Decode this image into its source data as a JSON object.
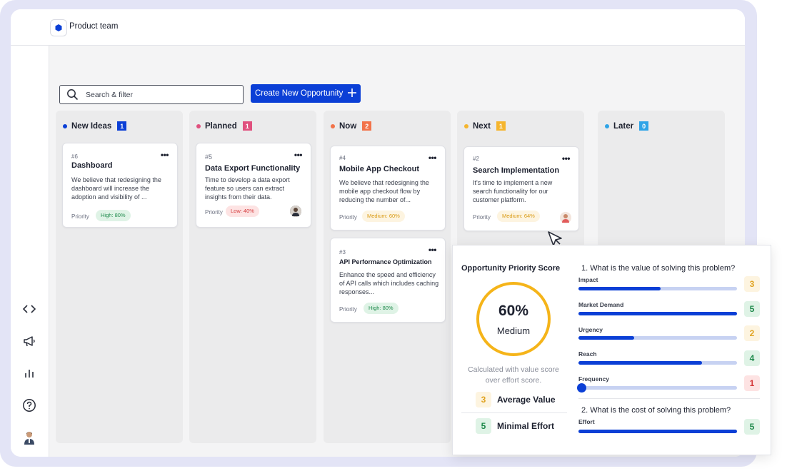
{
  "workspace": {
    "name": "Product team"
  },
  "toolbar": {
    "search_placeholder": "Search & filter",
    "create_label": "Create New Opportunity"
  },
  "colors": {
    "accent": "#0b3fd6",
    "high": "#1f9d55",
    "medium": "#e0a321",
    "low": "#e0484a"
  },
  "sidebar": {
    "icons": [
      "code-icon",
      "megaphone-icon",
      "bar-chart-icon",
      "help-icon",
      "user-avatar"
    ]
  },
  "columns": [
    {
      "name": "New Ideas",
      "count": "1",
      "color": "#0b3fd6",
      "cards": [
        {
          "num": "#6",
          "title": "Dashboard",
          "desc": "We believe that redesigning the dashboard will increase the adoption and visibility of ...",
          "priority_label": "Priority",
          "priority": "High: 80%"
        }
      ]
    },
    {
      "name": "Planned",
      "count": "1",
      "color": "#e0507e",
      "cards": [
        {
          "num": "#5",
          "title": "Data Export Functionality",
          "desc": "Time to develop a data export feature so users can extract insights from their data.",
          "priority_label": "Priority",
          "priority": "Low: 40%"
        }
      ]
    },
    {
      "name": "Now",
      "count": "2",
      "color": "#f2734a",
      "cards": [
        {
          "num": "#4",
          "title": "Mobile App Checkout",
          "desc": "We believe that redesigning the mobile app checkout flow by reducing the number of...",
          "priority_label": "Priority",
          "priority": "Medium: 60%"
        },
        {
          "num": "#3",
          "title": "API Performance Optimization",
          "desc": "Enhance the speed and efficiency of API calls which includes caching responses...",
          "priority_label": "Priority",
          "priority": "High: 80%"
        }
      ]
    },
    {
      "name": "Next",
      "count": "1",
      "color": "#f5b52e",
      "cards": [
        {
          "num": "#2",
          "title": "Search Implementation",
          "desc": "It's time to implement a new search functionality for our customer platform.",
          "priority_label": "Priority",
          "priority": "Medium: 64%"
        }
      ]
    },
    {
      "name": "Later",
      "count": "0",
      "color": "#2fa4e7",
      "cards": []
    }
  ],
  "score_panel": {
    "title": "Opportunity Priority Score",
    "percent": "60%",
    "percent_value": 0.6,
    "level": "Medium",
    "note": "Calculated with value score over effort score.",
    "average_value": {
      "score": "3",
      "label": "Average Value"
    },
    "minimal_effort": {
      "score": "5",
      "label": "Minimal Effort"
    },
    "q1": "1. What is the value of solving this problem?",
    "q2": "2. What is the cost of solving this problem?",
    "metrics": [
      {
        "label": "Impact",
        "score": "3",
        "fill": 0.52
      },
      {
        "label": "Market Demand",
        "score": "5",
        "fill": 1.0
      },
      {
        "label": "Urgency",
        "score": "2",
        "fill": 0.35
      },
      {
        "label": "Reach",
        "score": "4",
        "fill": 0.78
      },
      {
        "label": "Frequency",
        "score": "1",
        "fill": 0.0
      }
    ],
    "effort": {
      "label": "Effort",
      "score": "5",
      "fill": 1.0
    }
  }
}
